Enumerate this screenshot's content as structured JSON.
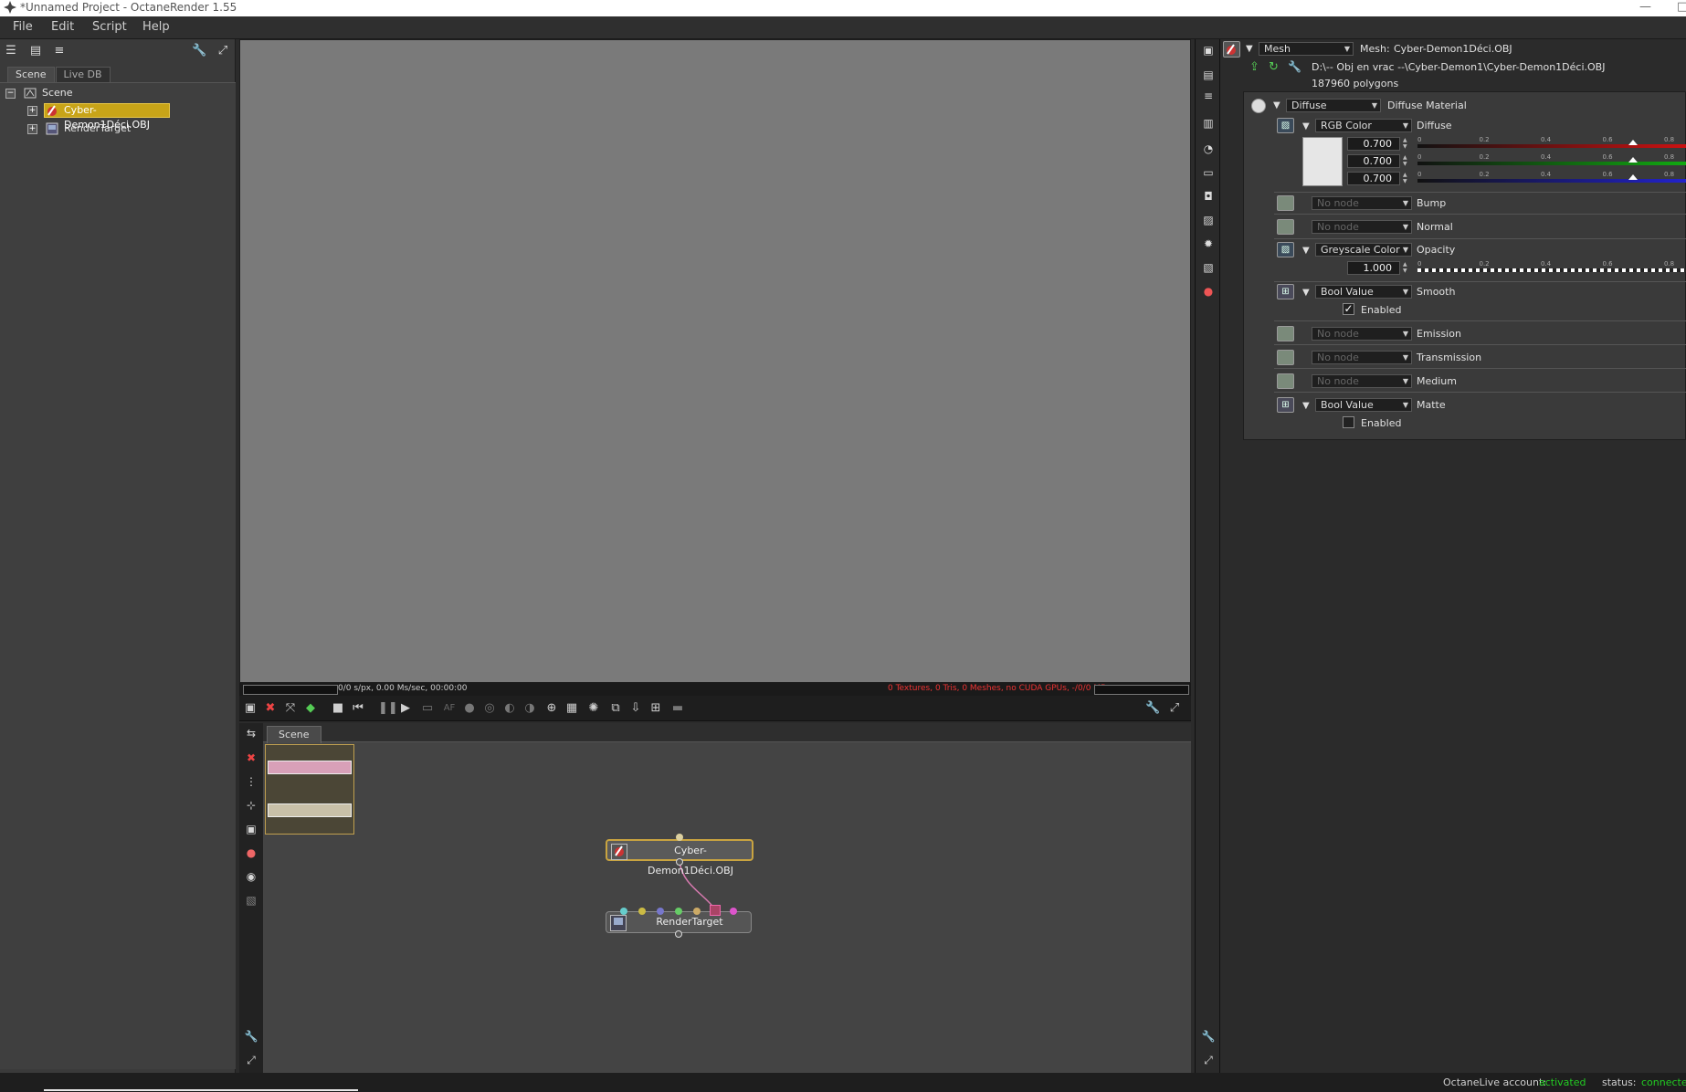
{
  "window": {
    "title": "*Unnamed Project - OctaneRender 1.55",
    "logo_icon": "octane-logo-icon"
  },
  "menu": [
    "File",
    "Edit",
    "Script",
    "Help"
  ],
  "outliner": {
    "tabs": [
      "Scene",
      "Live DB"
    ],
    "active_tab": "Scene",
    "items": [
      {
        "label": "Scene",
        "icon": "scene-icon"
      },
      {
        "label": "Cyber-Demon1Déci.OBJ",
        "icon": "mesh-icon",
        "selected": true
      },
      {
        "label": "RenderTarget",
        "icon": "render-target-icon"
      }
    ]
  },
  "render": {
    "stats": "0/0 s/px, 0.00 Ms/sec, 00:00:00",
    "gpu_info": "0 Textures, 0 Tris, 0 Meshes, no CUDA GPUs, -/0/0 MB"
  },
  "graph": {
    "tab": "Scene",
    "nodes": [
      {
        "label": "Cyber-Demon1Déci.OBJ"
      },
      {
        "label": "RenderTarget"
      }
    ]
  },
  "inspector": {
    "mesh_type": "Mesh",
    "mesh_label": "Mesh:",
    "mesh_name": "Cyber-Demon1Déci.OBJ",
    "path": "D:\\-- Obj en vrac --\\Cyber-Demon1\\Cyber-Demon1Déci.OBJ",
    "polygons": "187960 polygons",
    "material_type": "Diffuse",
    "material_label": "Diffuse Material",
    "diffuse": {
      "node": "RGB Color",
      "label": "Diffuse",
      "r": "0.700",
      "g": "0.700",
      "b": "0.700",
      "swatch_color": "#e6e6e6",
      "slider_ticks": [
        "0",
        "0.2",
        "0.4",
        "0.6",
        "0.8"
      ],
      "slider_value": 0.7
    },
    "bump": {
      "node": "No node",
      "label": "Bump"
    },
    "normal": {
      "node": "No node",
      "label": "Normal"
    },
    "opacity": {
      "node": "Greyscale Color",
      "label": "Opacity",
      "value": "1.000",
      "slider_value": 1.0
    },
    "smooth": {
      "node": "Bool Value",
      "label": "Smooth",
      "check_label": "Enabled",
      "checked": true
    },
    "emission": {
      "node": "No node",
      "label": "Emission"
    },
    "transmission": {
      "node": "No node",
      "label": "Transmission"
    },
    "medium": {
      "node": "No node",
      "label": "Medium"
    },
    "matte": {
      "node": "Bool Value",
      "label": "Matte",
      "check_label": "Enabled",
      "checked": false
    }
  },
  "status": {
    "account_label": "OctaneLive account:",
    "account_value": "activated",
    "status_label": "status:",
    "status_value": "connected",
    "value_color": "#22cc22"
  }
}
